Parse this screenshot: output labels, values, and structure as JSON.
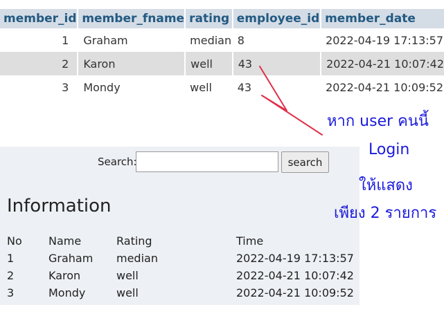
{
  "grid": {
    "headers": [
      "member_id",
      "member_fname",
      "rating",
      "employee_id",
      "member_date"
    ],
    "rows": [
      {
        "member_id": "1",
        "member_fname": "Graham",
        "rating": "median",
        "employee_id": "8",
        "member_date": "2022-04-19 17:13:57"
      },
      {
        "member_id": "2",
        "member_fname": "Karon",
        "rating": "well",
        "employee_id": "43",
        "member_date": "2022-04-21 10:07:42"
      },
      {
        "member_id": "3",
        "member_fname": "Mondy",
        "rating": "well",
        "employee_id": "43",
        "member_date": "2022-04-21 10:09:52"
      }
    ]
  },
  "search": {
    "label": "Search:",
    "value": "",
    "button_label": "search"
  },
  "info": {
    "title": "Information",
    "headers": [
      "No",
      "Name",
      "Rating",
      "Time"
    ],
    "rows": [
      {
        "no": "1",
        "name": "Graham",
        "rating": "median",
        "time": "2022-04-19 17:13:57"
      },
      {
        "no": "2",
        "name": "Karon",
        "rating": "well",
        "time": "2022-04-21 10:07:42"
      },
      {
        "no": "3",
        "name": "Mondy",
        "rating": "well",
        "time": "2022-04-21 10:09:52"
      }
    ]
  },
  "annotation": {
    "lines": [
      "หาก user คนนี้",
      "Login",
      "ให้แสดง",
      "เพียง 2 รายการ"
    ],
    "color": "#1a1adc",
    "arrow_color": "#e0304a"
  }
}
